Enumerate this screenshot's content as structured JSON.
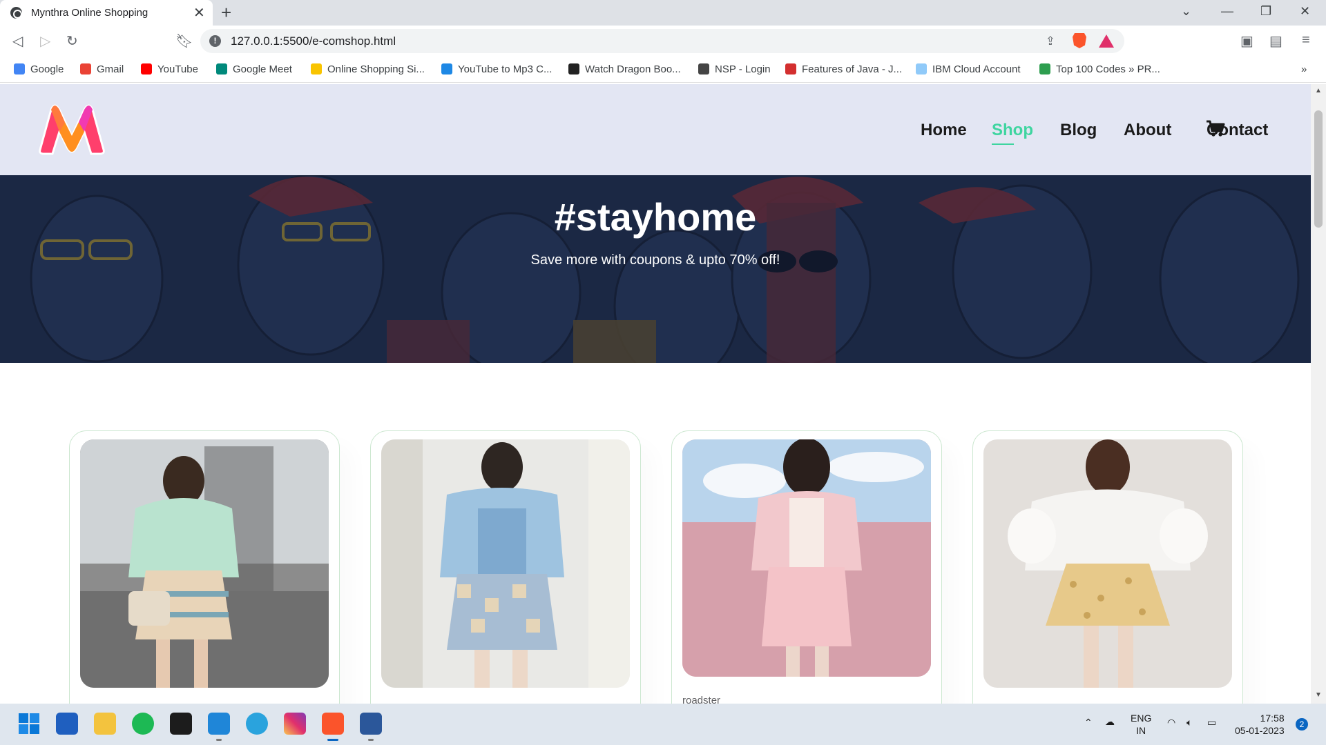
{
  "browser": {
    "tab_title": "Mynthra Online Shopping",
    "url": "127.0.0.1:5500/e-comshop.html",
    "bookmarks": [
      {
        "label": "Google",
        "color": "#4285f4"
      },
      {
        "label": "Gmail",
        "color": "#ea4335"
      },
      {
        "label": "YouTube",
        "color": "#ff0000"
      },
      {
        "label": "Google Meet",
        "color": "#00897b"
      },
      {
        "label": "Online Shopping Si...",
        "color": "#f9c400"
      },
      {
        "label": "YouTube to Mp3 C...",
        "color": "#1e88e5"
      },
      {
        "label": "Watch Dragon Boo...",
        "color": "#222222"
      },
      {
        "label": "NSP - Login",
        "color": "#444444"
      },
      {
        "label": "Features of Java - J...",
        "color": "#d32f2f"
      },
      {
        "label": "IBM Cloud Account",
        "color": "#90caf9"
      },
      {
        "label": "Top 100 Codes » PR...",
        "color": "#2e9e4f"
      }
    ]
  },
  "site": {
    "nav": {
      "home": "Home",
      "shop": "Shop",
      "blog": "Blog",
      "about": "About",
      "contact": "Contact"
    },
    "accent_color": "#3fd5a0",
    "hero": {
      "title": "#stayhome",
      "subtitle": "Save more with coupons & upto 70% off!"
    },
    "products": [
      {
        "brand": ""
      },
      {
        "brand": ""
      },
      {
        "brand": "roadster"
      },
      {
        "brand": ""
      }
    ]
  },
  "taskbar": {
    "lang_top": "ENG",
    "lang_bottom": "IN",
    "time": "17:58",
    "date": "05-01-2023",
    "notif_count": "2"
  }
}
